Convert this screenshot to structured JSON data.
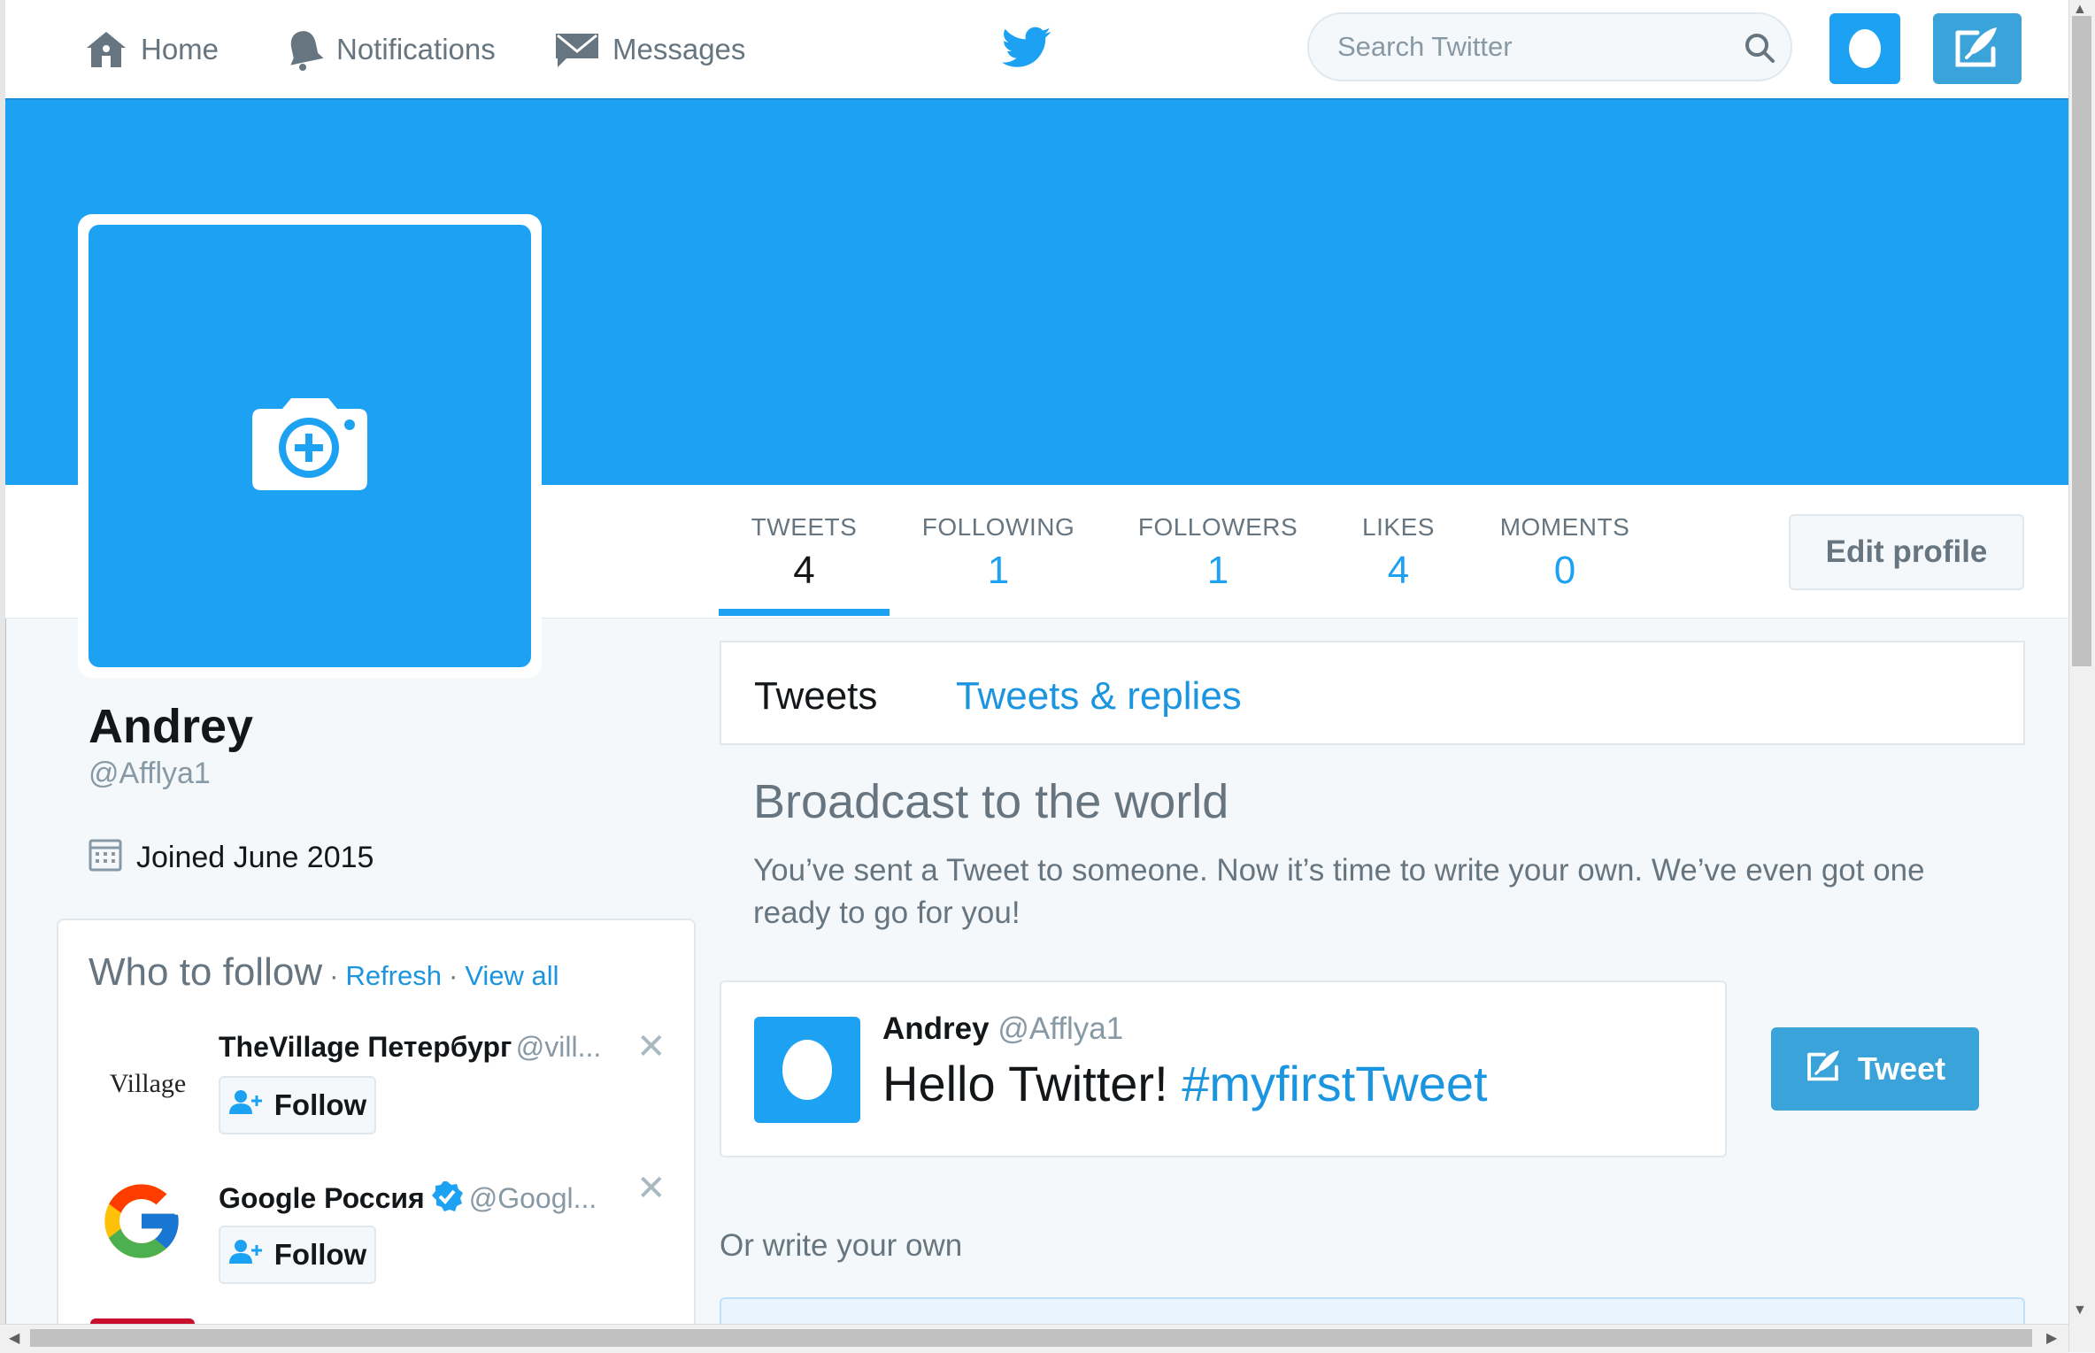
{
  "nav": {
    "home_label": "Home",
    "notifications_label": "Notifications",
    "messages_label": "Messages",
    "search_placeholder": "Search Twitter",
    "icons": {
      "home": "home-icon",
      "notifications": "bell-icon",
      "messages": "envelope-icon",
      "logo": "twitter-bird-icon",
      "search": "search-icon",
      "compose": "compose-tweet-icon"
    }
  },
  "colors": {
    "brand": "#1da1f2",
    "link": "#1b95e0",
    "button": "#3aa3d9",
    "muted": "#66757f"
  },
  "profile": {
    "name": "Andrey",
    "handle": "@Afflya1",
    "joined": "Joined June 2015"
  },
  "stats": [
    {
      "label": "TWEETS",
      "value": "4"
    },
    {
      "label": "FOLLOWING",
      "value": "1"
    },
    {
      "label": "FOLLOWERS",
      "value": "1"
    },
    {
      "label": "LIKES",
      "value": "4"
    },
    {
      "label": "MOMENTS",
      "value": "0"
    }
  ],
  "edit_profile_label": "Edit profile",
  "who_to_follow": {
    "title": "Who to follow",
    "refresh_label": "Refresh",
    "view_all_label": "View all",
    "accounts": [
      {
        "name": "TheVillage Петербург",
        "handle": "@vill...",
        "logo_text": "Village",
        "follow_label": "Follow"
      },
      {
        "name": "Google Россия",
        "handle": "@Googl...",
        "verified": true,
        "follow_label": "Follow"
      }
    ]
  },
  "timeline": {
    "tab_tweets": "Tweets",
    "tab_replies": "Tweets & replies",
    "broadcast_title": "Broadcast to the world",
    "broadcast_text": "You’ve sent a Tweet to someone. Now it’s time to write your own. We’ve even got one ready to go for you!",
    "suggested": {
      "name": "Andrey",
      "handle": "@Afflya1",
      "text": "Hello Twitter! ",
      "hashtag": "#myfirstTweet"
    },
    "tweet_button_label": "Tweet",
    "or_write_own": "Or write your own"
  }
}
